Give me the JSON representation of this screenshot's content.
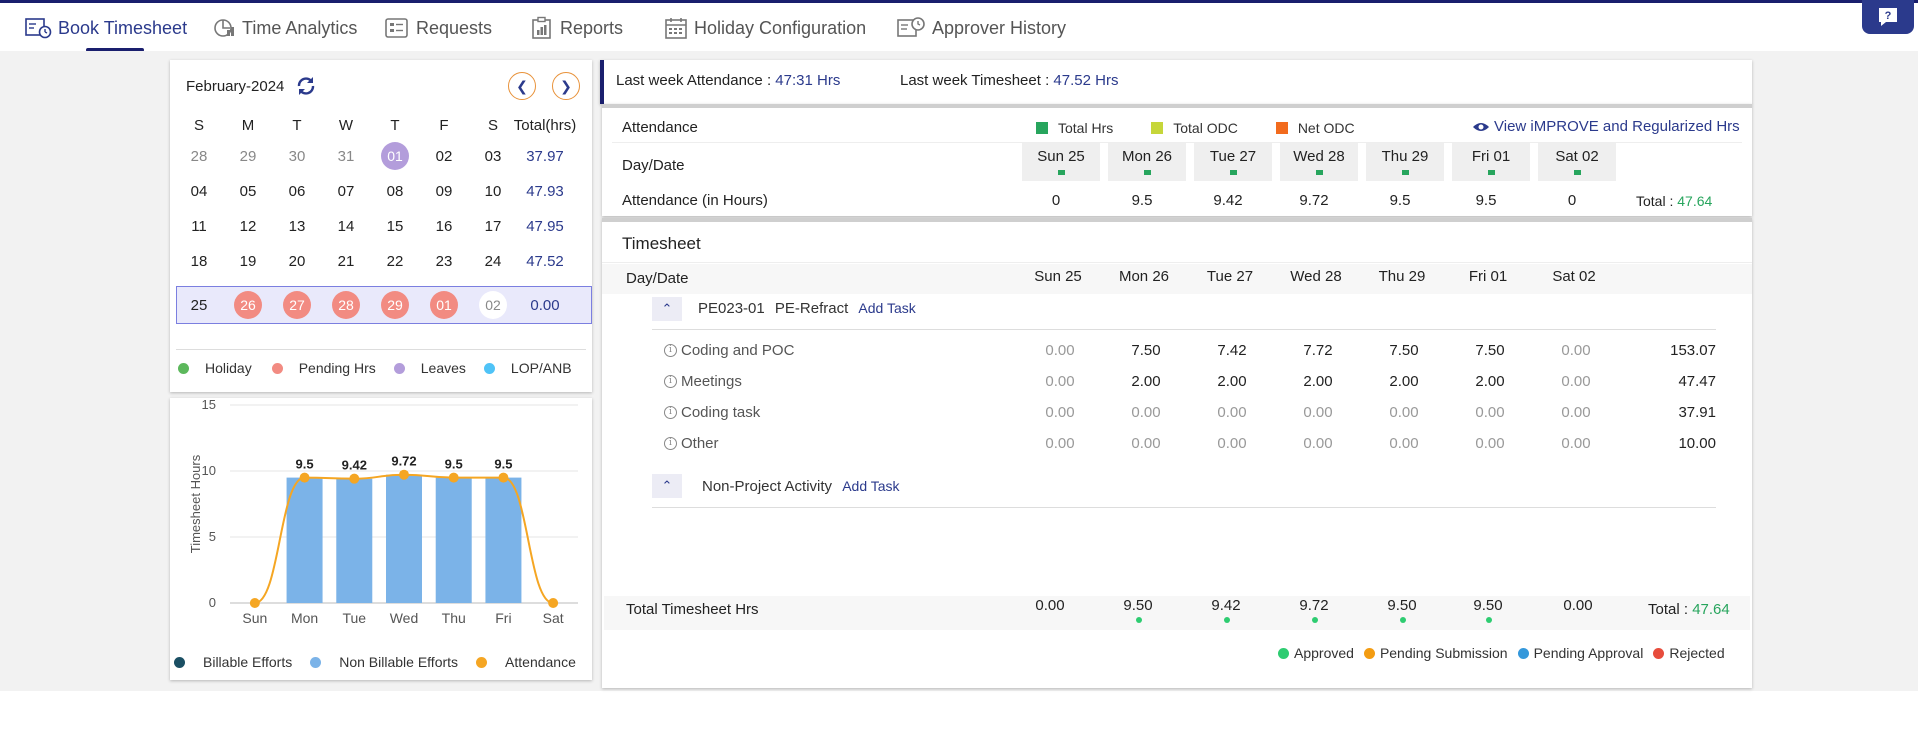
{
  "nav": {
    "items": [
      {
        "label": "Book Timesheet",
        "icon": "timesheet-icon",
        "active": true
      },
      {
        "label": "Time Analytics",
        "icon": "analytics-icon"
      },
      {
        "label": "Requests",
        "icon": "requests-icon"
      },
      {
        "label": "Reports",
        "icon": "reports-icon"
      },
      {
        "label": "Holiday Configuration",
        "icon": "calendar-icon"
      },
      {
        "label": "Approver History",
        "icon": "history-icon"
      }
    ]
  },
  "calendar": {
    "month": "February-2024",
    "headers": [
      "S",
      "M",
      "T",
      "W",
      "T",
      "F",
      "S",
      "Total(hrs)"
    ],
    "weeks": [
      {
        "days": [
          "28",
          "29",
          "30",
          "31",
          "01",
          "02",
          "03"
        ],
        "total": "37.97"
      },
      {
        "days": [
          "04",
          "05",
          "06",
          "07",
          "08",
          "09",
          "10"
        ],
        "total": "47.93"
      },
      {
        "days": [
          "11",
          "12",
          "13",
          "14",
          "15",
          "16",
          "17"
        ],
        "total": "47.95"
      },
      {
        "days": [
          "18",
          "19",
          "20",
          "21",
          "22",
          "23",
          "24"
        ],
        "total": "47.52"
      },
      {
        "days": [
          "25",
          "26",
          "27",
          "28",
          "29",
          "01",
          "02"
        ],
        "total": "0.00"
      }
    ],
    "legend": [
      "Holiday",
      "Pending Hrs",
      "Leaves",
      "LOP/ANB"
    ],
    "colors": {
      "holiday": "#5cb85c",
      "pending": "#f28b82",
      "leaves": "#b39ddb",
      "lop": "#4fc3f7"
    }
  },
  "chart_data": {
    "type": "bar",
    "categories": [
      "Sun",
      "Mon",
      "Tue",
      "Wed",
      "Thu",
      "Fri",
      "Sat"
    ],
    "series": [
      {
        "name": "Non Billable Efforts",
        "values": [
          0,
          9.5,
          9.42,
          9.72,
          9.5,
          9.5,
          0
        ]
      },
      {
        "name": "Attendance",
        "values": [
          0,
          9.5,
          9.42,
          9.72,
          9.5,
          9.5,
          0
        ]
      }
    ],
    "data_labels": [
      "9.5",
      "9.42",
      "9.72",
      "9.5",
      "9.5"
    ],
    "ylabel": "Timesheet Hours",
    "yticks": [
      "0",
      "5",
      "10",
      "15"
    ],
    "ylim": [
      0,
      15
    ],
    "legend": [
      "Billable Efforts",
      "Non Billable Efforts",
      "Attendance"
    ],
    "colors": {
      "billable": "#1a4f63",
      "non_billable": "#7bb3e8",
      "attendance": "#f5a623"
    }
  },
  "summary": {
    "attendance_label": "Last week Attendance : ",
    "attendance_value": "47:31 Hrs",
    "timesheet_label": "Last week Timesheet : ",
    "timesheet_value": "47.52 Hrs"
  },
  "attendance": {
    "title": "Attendance",
    "legend": [
      "Total Hrs",
      "Total ODC",
      "Net ODC"
    ],
    "legend_colors": [
      "#27a55d",
      "#c6d63a",
      "#f26b1d"
    ],
    "link": "View iMPROVE and Regularized Hrs",
    "day_label": "Day/Date",
    "days": [
      "Sun 25",
      "Mon 26",
      "Tue 27",
      "Wed 28",
      "Thu 29",
      "Fri 01",
      "Sat 02"
    ],
    "hours_label": "Attendance (in Hours)",
    "hours": [
      "0",
      "9.5",
      "9.42",
      "9.72",
      "9.5",
      "9.5",
      "0"
    ],
    "total_label": "Total : ",
    "total_value": "47.64"
  },
  "timesheet": {
    "title": "Timesheet",
    "day_label": "Day/Date",
    "days": [
      "Sun 25",
      "Mon 26",
      "Tue 27",
      "Wed 28",
      "Thu 29",
      "Fri 01",
      "Sat 02"
    ],
    "project": {
      "code": "PE023-01",
      "name": "PE-Refract",
      "add_task": "Add Task"
    },
    "tasks": [
      {
        "name": "Coding and POC",
        "values": [
          "0.00",
          "7.50",
          "7.42",
          "7.72",
          "7.50",
          "7.50",
          "0.00"
        ],
        "total": "153.07"
      },
      {
        "name": "Meetings",
        "values": [
          "0.00",
          "2.00",
          "2.00",
          "2.00",
          "2.00",
          "2.00",
          "0.00"
        ],
        "total": "47.47"
      },
      {
        "name": "Coding task",
        "values": [
          "0.00",
          "0.00",
          "0.00",
          "0.00",
          "0.00",
          "0.00",
          "0.00"
        ],
        "total": "37.91"
      },
      {
        "name": "Other",
        "values": [
          "0.00",
          "0.00",
          "0.00",
          "0.00",
          "0.00",
          "0.00",
          "0.00"
        ],
        "total": "10.00"
      }
    ],
    "non_project": {
      "name": "Non-Project Activity",
      "add_task": "Add Task"
    },
    "total_label": "Total Timesheet Hrs",
    "totals": [
      "0.00",
      "9.50",
      "9.42",
      "9.72",
      "9.50",
      "9.50",
      "0.00"
    ],
    "grand_total_label": "Total : ",
    "grand_total": "47.64",
    "status_legend": [
      "Approved",
      "Pending Submission",
      "Pending Approval",
      "Rejected"
    ],
    "status_colors": [
      "#2ecc71",
      "#f39c12",
      "#3498db",
      "#e74c3c"
    ]
  }
}
